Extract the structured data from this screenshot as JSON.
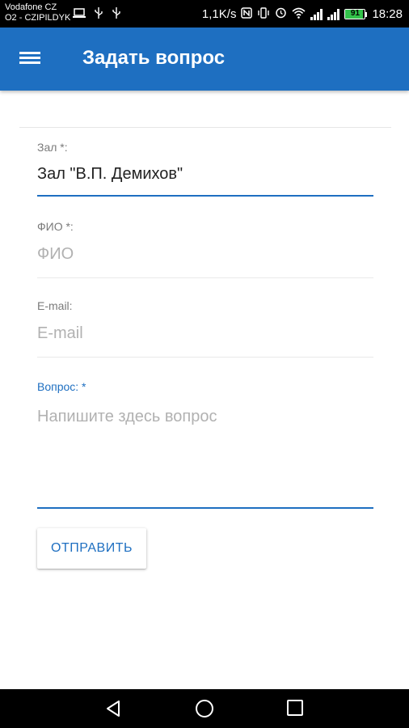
{
  "status_bar": {
    "carrier_line1": "Vodafone CZ",
    "carrier_line2": "O2 - CZIPILDYK",
    "speed": "1,1K/s",
    "battery_level": "91",
    "battery_color": "#33c24a",
    "time": "18:28",
    "icons": [
      "laptop-icon",
      "usb-icon",
      "usb-icon",
      "nfc-icon",
      "vibrate-icon",
      "alarm-icon",
      "wifi-icon",
      "signal-icon",
      "signal-icon",
      "battery-icon"
    ]
  },
  "app_bar": {
    "title": "Задать вопрос",
    "color": "#1e6fc1"
  },
  "form": {
    "hall": {
      "label": "Зал *:",
      "value": "Зал \"В.П. Демихов\""
    },
    "name": {
      "label": "ФИО *:",
      "placeholder": "ФИО"
    },
    "email": {
      "label": "E-mail:",
      "placeholder": "E-mail"
    },
    "question": {
      "label": "Вопрос: *",
      "placeholder": "Напишите здесь вопрос"
    },
    "submit_label": "ОТПРАВИТЬ"
  },
  "nav_bar": {
    "buttons": [
      "back-icon",
      "home-icon",
      "recents-icon"
    ]
  }
}
